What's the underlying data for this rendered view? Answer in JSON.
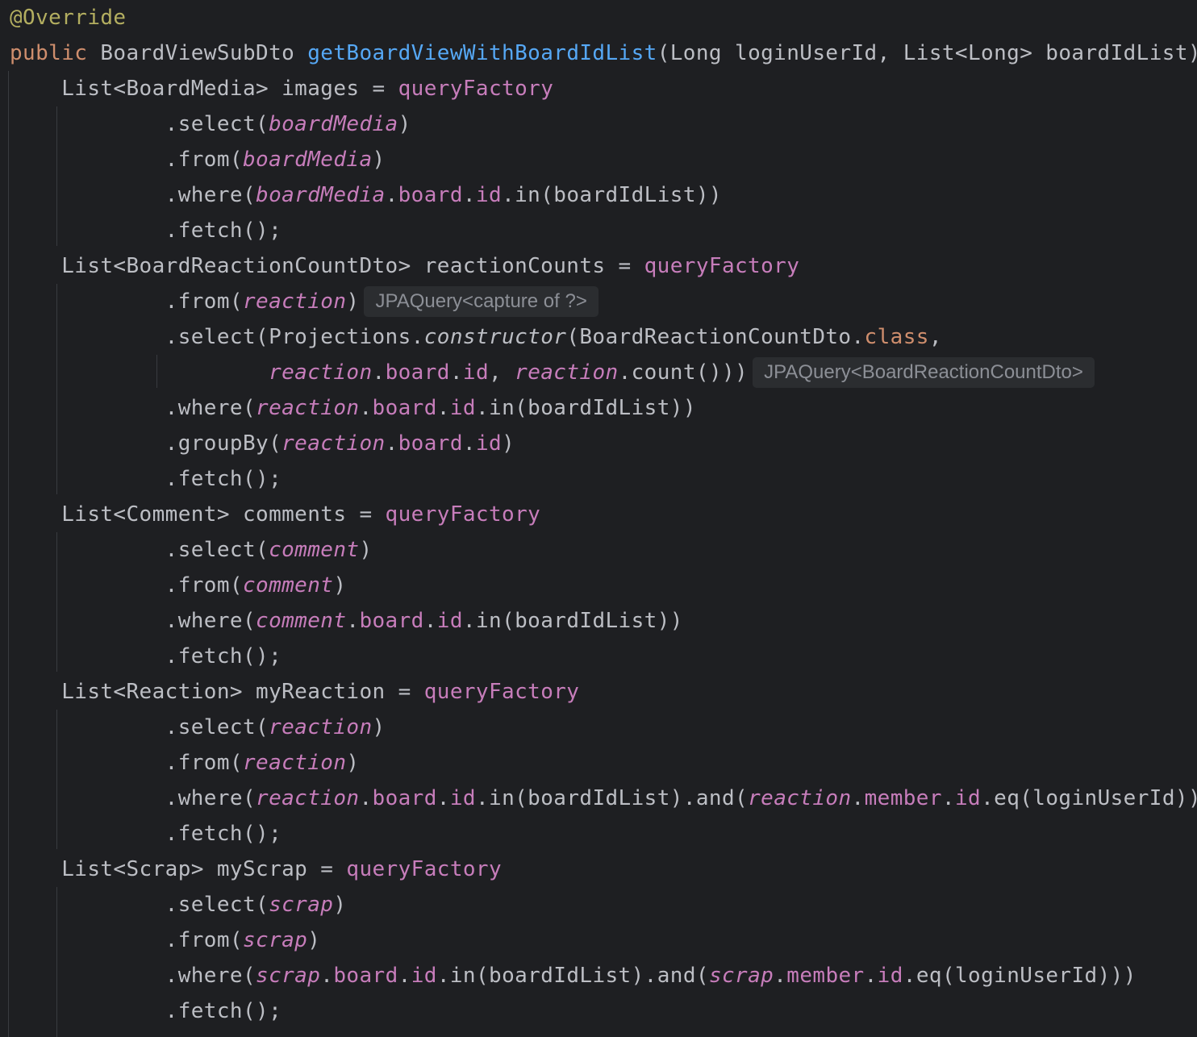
{
  "editor": {
    "colors": {
      "background": "#1e1f22",
      "default": "#bcbec4",
      "keyword": "#cf8e6d",
      "annotation": "#b3ae60",
      "method": "#56a8f5",
      "field": "#c77dbb",
      "hint_text": "#8c8f96",
      "hint_background": "#2b2d30"
    },
    "lines": [
      {
        "tokens": [
          {
            "t": "@Override",
            "c": "annotation"
          }
        ]
      },
      {
        "tokens": [
          {
            "t": "public",
            "c": "keyword"
          },
          {
            "t": " BoardViewSubDto "
          },
          {
            "t": "getBoardViewWithBoardIdList",
            "c": "method"
          },
          {
            "t": "(Long loginUserId, List<Long> boardIdList) {"
          }
        ]
      },
      {
        "tokens": [
          {
            "t": "    List<BoardMedia> images = "
          },
          {
            "t": "queryFactory",
            "c": "field"
          }
        ]
      },
      {
        "tokens": [
          {
            "t": "            .select("
          },
          {
            "t": "boardMedia",
            "c": "field-italic"
          },
          {
            "t": ")"
          }
        ]
      },
      {
        "tokens": [
          {
            "t": "            .from("
          },
          {
            "t": "boardMedia",
            "c": "field-italic"
          },
          {
            "t": ")"
          }
        ]
      },
      {
        "tokens": [
          {
            "t": "            .where("
          },
          {
            "t": "boardMedia",
            "c": "field-italic"
          },
          {
            "t": "."
          },
          {
            "t": "board",
            "c": "field"
          },
          {
            "t": "."
          },
          {
            "t": "id",
            "c": "field"
          },
          {
            "t": ".in(boardIdList))"
          }
        ]
      },
      {
        "tokens": [
          {
            "t": "            .fetch();"
          }
        ]
      },
      {
        "tokens": [
          {
            "t": "    List<BoardReactionCountDto> reactionCounts = "
          },
          {
            "t": "queryFactory",
            "c": "field"
          }
        ]
      },
      {
        "tokens": [
          {
            "t": "            .from("
          },
          {
            "t": "reaction",
            "c": "field-italic"
          },
          {
            "t": ")"
          },
          {
            "t": "JPAQuery<capture of ?>",
            "c": "hint"
          }
        ]
      },
      {
        "tokens": [
          {
            "t": "            .select(Projections."
          },
          {
            "t": "constructor",
            "c": "italic"
          },
          {
            "t": "(BoardReactionCountDto."
          },
          {
            "t": "class",
            "c": "keyword"
          },
          {
            "t": ","
          }
        ]
      },
      {
        "tokens": [
          {
            "t": "                    "
          },
          {
            "t": "reaction",
            "c": "field-italic"
          },
          {
            "t": "."
          },
          {
            "t": "board",
            "c": "field"
          },
          {
            "t": "."
          },
          {
            "t": "id",
            "c": "field"
          },
          {
            "t": ", "
          },
          {
            "t": "reaction",
            "c": "field-italic"
          },
          {
            "t": ".count()))"
          },
          {
            "t": "JPAQuery<BoardReactionCountDto>",
            "c": "hint"
          }
        ]
      },
      {
        "tokens": [
          {
            "t": "            .where("
          },
          {
            "t": "reaction",
            "c": "field-italic"
          },
          {
            "t": "."
          },
          {
            "t": "board",
            "c": "field"
          },
          {
            "t": "."
          },
          {
            "t": "id",
            "c": "field"
          },
          {
            "t": ".in(boardIdList))"
          }
        ]
      },
      {
        "tokens": [
          {
            "t": "            .groupBy("
          },
          {
            "t": "reaction",
            "c": "field-italic"
          },
          {
            "t": "."
          },
          {
            "t": "board",
            "c": "field"
          },
          {
            "t": "."
          },
          {
            "t": "id",
            "c": "field"
          },
          {
            "t": ")"
          }
        ]
      },
      {
        "tokens": [
          {
            "t": "            .fetch();"
          }
        ]
      },
      {
        "tokens": [
          {
            "t": "    List<Comment> comments = "
          },
          {
            "t": "queryFactory",
            "c": "field"
          }
        ]
      },
      {
        "tokens": [
          {
            "t": "            .select("
          },
          {
            "t": "comment",
            "c": "field-italic"
          },
          {
            "t": ")"
          }
        ]
      },
      {
        "tokens": [
          {
            "t": "            .from("
          },
          {
            "t": "comment",
            "c": "field-italic"
          },
          {
            "t": ")"
          }
        ]
      },
      {
        "tokens": [
          {
            "t": "            .where("
          },
          {
            "t": "comment",
            "c": "field-italic"
          },
          {
            "t": "."
          },
          {
            "t": "board",
            "c": "field"
          },
          {
            "t": "."
          },
          {
            "t": "id",
            "c": "field"
          },
          {
            "t": ".in(boardIdList))"
          }
        ]
      },
      {
        "tokens": [
          {
            "t": "            .fetch();"
          }
        ]
      },
      {
        "tokens": [
          {
            "t": "    List<Reaction> myReaction = "
          },
          {
            "t": "queryFactory",
            "c": "field"
          }
        ]
      },
      {
        "tokens": [
          {
            "t": "            .select("
          },
          {
            "t": "reaction",
            "c": "field-italic"
          },
          {
            "t": ")"
          }
        ]
      },
      {
        "tokens": [
          {
            "t": "            .from("
          },
          {
            "t": "reaction",
            "c": "field-italic"
          },
          {
            "t": ")"
          }
        ]
      },
      {
        "tokens": [
          {
            "t": "            .where("
          },
          {
            "t": "reaction",
            "c": "field-italic"
          },
          {
            "t": "."
          },
          {
            "t": "board",
            "c": "field"
          },
          {
            "t": "."
          },
          {
            "t": "id",
            "c": "field"
          },
          {
            "t": ".in(boardIdList).and("
          },
          {
            "t": "reaction",
            "c": "field-italic"
          },
          {
            "t": "."
          },
          {
            "t": "member",
            "c": "field"
          },
          {
            "t": "."
          },
          {
            "t": "id",
            "c": "field"
          },
          {
            "t": ".eq(loginUserId)))"
          }
        ]
      },
      {
        "tokens": [
          {
            "t": "            .fetch();"
          }
        ]
      },
      {
        "tokens": [
          {
            "t": "    List<Scrap> myScrap = "
          },
          {
            "t": "queryFactory",
            "c": "field"
          }
        ]
      },
      {
        "tokens": [
          {
            "t": "            .select("
          },
          {
            "t": "scrap",
            "c": "field-italic"
          },
          {
            "t": ")"
          }
        ]
      },
      {
        "tokens": [
          {
            "t": "            .from("
          },
          {
            "t": "scrap",
            "c": "field-italic"
          },
          {
            "t": ")"
          }
        ]
      },
      {
        "tokens": [
          {
            "t": "            .where("
          },
          {
            "t": "scrap",
            "c": "field-italic"
          },
          {
            "t": "."
          },
          {
            "t": "board",
            "c": "field"
          },
          {
            "t": "."
          },
          {
            "t": "id",
            "c": "field"
          },
          {
            "t": ".in(boardIdList).and("
          },
          {
            "t": "scrap",
            "c": "field-italic"
          },
          {
            "t": "."
          },
          {
            "t": "member",
            "c": "field"
          },
          {
            "t": "."
          },
          {
            "t": "id",
            "c": "field"
          },
          {
            "t": ".eq(loginUserId)))"
          }
        ]
      },
      {
        "tokens": [
          {
            "t": "            .fetch();"
          }
        ]
      }
    ]
  }
}
